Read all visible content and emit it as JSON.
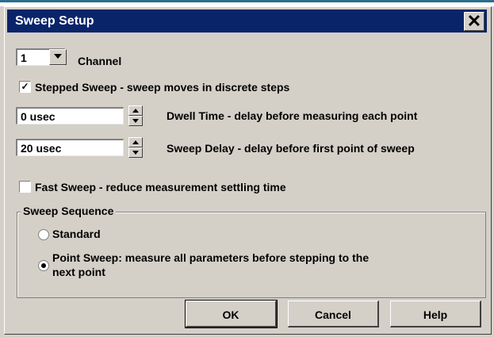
{
  "window": {
    "title": "Sweep Setup",
    "close_glyph": "✕"
  },
  "channel": {
    "value": "1",
    "label": "Channel"
  },
  "stepped_sweep": {
    "checked": true,
    "label": "Stepped Sweep - sweep moves in discrete steps"
  },
  "dwell_time": {
    "value": "0 usec",
    "label": "Dwell Time - delay before measuring each point"
  },
  "sweep_delay": {
    "value": "20 usec",
    "label": "Sweep Delay - delay before first point of sweep"
  },
  "fast_sweep": {
    "checked": false,
    "label": "Fast Sweep - reduce measurement settling time"
  },
  "sweep_sequence": {
    "title": "Sweep Sequence",
    "options": [
      {
        "label": "Standard",
        "selected": false
      },
      {
        "label_line1": "Point Sweep: measure all parameters before stepping to the",
        "label_line2": "next point",
        "selected": true
      }
    ]
  },
  "buttons": {
    "ok": "OK",
    "cancel": "Cancel",
    "help": "Help"
  },
  "colors": {
    "title_bar": "#0a246a",
    "face": "#d4d0c8"
  }
}
